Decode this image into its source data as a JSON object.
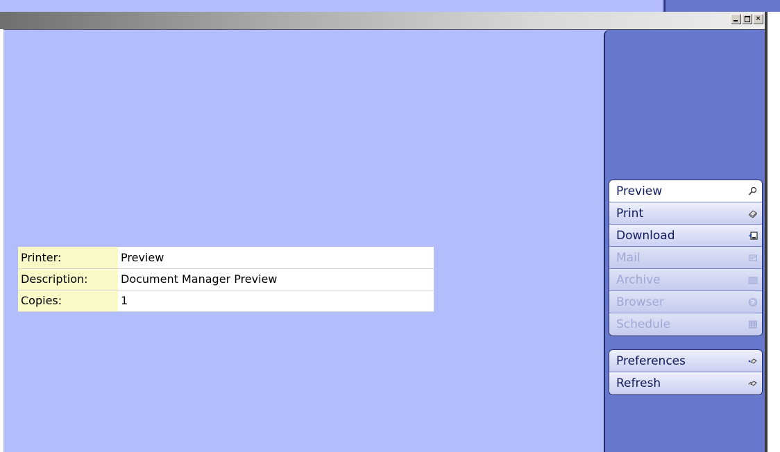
{
  "window": {
    "controls": {
      "minimize": "_",
      "maximize": "□",
      "close": "×"
    }
  },
  "printer_info": {
    "rows": [
      {
        "label": "Printer:",
        "value": "Preview"
      },
      {
        "label": "Description:",
        "value": "Document Manager Preview"
      },
      {
        "label": "Copies:",
        "value": "1"
      }
    ]
  },
  "menu": {
    "actions": [
      {
        "label": "Preview",
        "icon": "magnifier-icon",
        "state": "active"
      },
      {
        "label": "Print",
        "icon": "printer-icon",
        "state": "enabled"
      },
      {
        "label": "Download",
        "icon": "download-icon",
        "state": "enabled"
      },
      {
        "label": "Mail",
        "icon": "mail-icon",
        "state": "disabled"
      },
      {
        "label": "Archive",
        "icon": "archive-icon",
        "state": "disabled"
      },
      {
        "label": "Browser",
        "icon": "globe-icon",
        "state": "disabled"
      },
      {
        "label": "Schedule",
        "icon": "calendar-icon",
        "state": "disabled"
      }
    ],
    "settings": [
      {
        "label": "Preferences",
        "icon": "preferences-icon",
        "state": "enabled"
      },
      {
        "label": "Refresh",
        "icon": "refresh-icon",
        "state": "enabled"
      }
    ]
  },
  "colors": {
    "background": "#b3bdfb",
    "sidebar": "#6777cb",
    "label_cell": "#fafac9",
    "menu_text": "#0f1a5a",
    "menu_disabled_text": "#9ea8d6"
  }
}
